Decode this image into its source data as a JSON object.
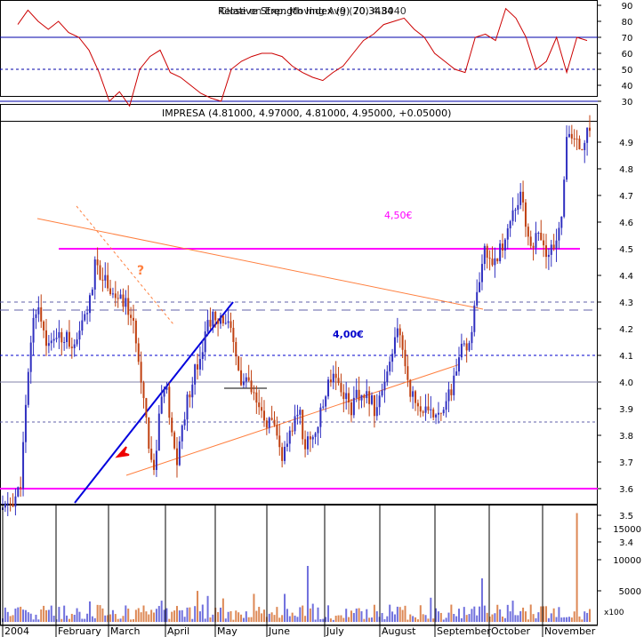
{
  "rsi_panel": {
    "overlay_label": "Relative Strength Index (9) 70.3434",
    "overlay_label_2": "Close on Exp. Moving Avg (20) 4.8040",
    "y_ticks": [
      90,
      80,
      70,
      60,
      50,
      40,
      30
    ],
    "levels": [
      70,
      30
    ],
    "dashed_level": 50
  },
  "price_panel": {
    "title": "IMPRESA (4.81000, 4.97000, 4.81000, 4.95000, +0.05000)",
    "y_ticks": [
      4.9,
      4.8,
      4.7,
      4.6,
      4.5,
      4.4,
      4.3,
      4.2,
      4.1,
      4.0,
      3.9,
      3.8,
      3.7,
      3.6,
      3.5,
      3.4
    ],
    "ylim": [
      3.37,
      5.0
    ],
    "annotation_450": "4,50€",
    "annotation_400": "4,00€",
    "annotation_question": "?",
    "support_level": 3.6,
    "resistance_level": 4.5
  },
  "volume_panel": {
    "y_ticks": [
      15000,
      10000,
      5000
    ],
    "unit_label": "x100"
  },
  "x_axis": {
    "labels": [
      "2004",
      "February",
      "March",
      "April",
      "May",
      "June",
      "July",
      "August",
      "September",
      "October",
      "November"
    ]
  },
  "colors": {
    "up": "#3030c0",
    "down": "#c04010",
    "rsi_line": "#cc0000",
    "magenta": "#ff00ff",
    "trend_orange": "#ff8040",
    "trend_blue": "#0000dd",
    "vol_up": "#7070dd",
    "vol_down": "#dd8855"
  },
  "chart_data": {
    "type": "candlestick",
    "title": "IMPRESA",
    "x": [
      "2004",
      "February",
      "March",
      "April",
      "May",
      "June",
      "July",
      "August",
      "September",
      "October",
      "November"
    ],
    "close_path": [
      3.52,
      3.54,
      3.56,
      3.6,
      3.9,
      4.2,
      4.3,
      4.2,
      4.12,
      4.18,
      4.15,
      4.2,
      4.1,
      4.15,
      4.25,
      4.3,
      4.45,
      4.4,
      4.38,
      4.33,
      4.3,
      4.3,
      4.25,
      4.15,
      4.0,
      3.8,
      3.65,
      3.9,
      4.0,
      3.8,
      3.7,
      3.85,
      3.95,
      4.05,
      4.1,
      4.2,
      4.25,
      4.2,
      4.25,
      4.2,
      4.1,
      4.0,
      4.0,
      3.95,
      3.9,
      3.85,
      3.85,
      3.8,
      3.72,
      3.75,
      3.85,
      3.9,
      3.75,
      3.8,
      3.82,
      3.9,
      4.0,
      4.05,
      3.98,
      3.95,
      3.9,
      3.95,
      3.92,
      3.95,
      3.9,
      3.95,
      4.0,
      4.1,
      4.2,
      4.1,
      3.98,
      3.92,
      3.9,
      3.88,
      3.87,
      3.9,
      3.92,
      3.95,
      4.05,
      4.12,
      4.12,
      4.25,
      4.35,
      4.5,
      4.45,
      4.48,
      4.5,
      4.6,
      4.65,
      4.7,
      4.6,
      4.5,
      4.55,
      4.5,
      4.48,
      4.5,
      4.6,
      4.9,
      4.92,
      4.88,
      4.9,
      4.95
    ],
    "rsi_path": [
      78,
      87,
      80,
      75,
      80,
      73,
      70,
      62,
      48,
      30,
      36,
      27,
      50,
      58,
      62,
      48,
      45,
      40,
      35,
      32,
      30,
      50,
      55,
      58,
      60,
      60,
      58,
      52,
      48,
      45,
      43,
      48,
      52,
      60,
      68,
      72,
      78,
      80,
      82,
      75,
      70,
      60,
      55,
      50,
      48,
      70,
      72,
      68,
      88,
      82,
      70,
      50,
      55,
      70,
      48,
      70,
      68
    ],
    "volume_peaks": [
      {
        "x": "June",
        "value": 9000
      },
      {
        "x": "September",
        "value": 7000
      },
      {
        "x": "November",
        "value": 17500
      }
    ],
    "ylim": [
      3.37,
      5.0
    ],
    "xlabel": "",
    "ylabel": ""
  }
}
